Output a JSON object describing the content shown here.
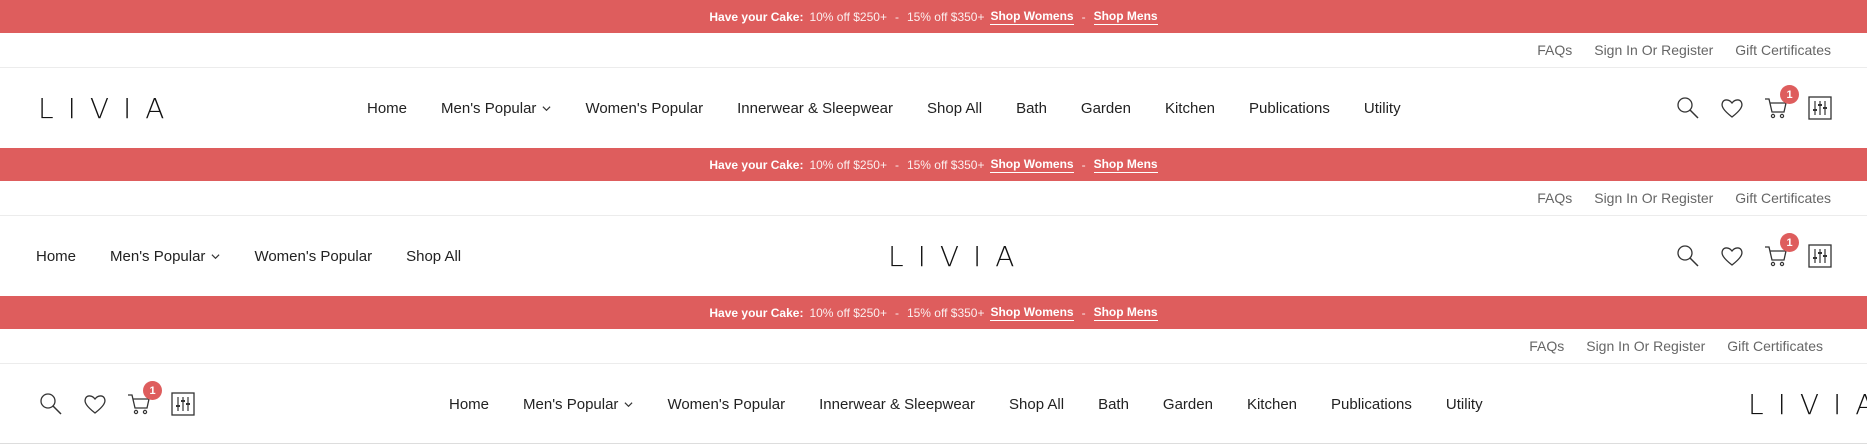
{
  "promo": {
    "lead": "Have your Cake:",
    "offer1": "10% off $250+",
    "dash1": "-",
    "offer2": "15% off $350+",
    "link_women": "Shop Womens",
    "dash2": "-",
    "link_men": "Shop Mens"
  },
  "topbar": {
    "faqs": "FAQs",
    "signin": "Sign In Or Register",
    "gift": "Gift Certificates"
  },
  "logo": "LIVIA",
  "nav_full": [
    "Home",
    "Men's Popular",
    "Women's Popular",
    "Innerwear & Sleepwear",
    "Shop All",
    "Bath",
    "Garden",
    "Kitchen",
    "Publications",
    "Utility"
  ],
  "nav_short": [
    "Home",
    "Men's Popular",
    "Women's Popular",
    "Shop All"
  ],
  "cart_count": "1",
  "colors": {
    "accent": "#de5d5d",
    "text": "#222222",
    "muted": "#666666"
  },
  "icons": [
    "search-icon",
    "heart-icon",
    "cart-icon",
    "compare-icon",
    "chevron-down-icon"
  ]
}
